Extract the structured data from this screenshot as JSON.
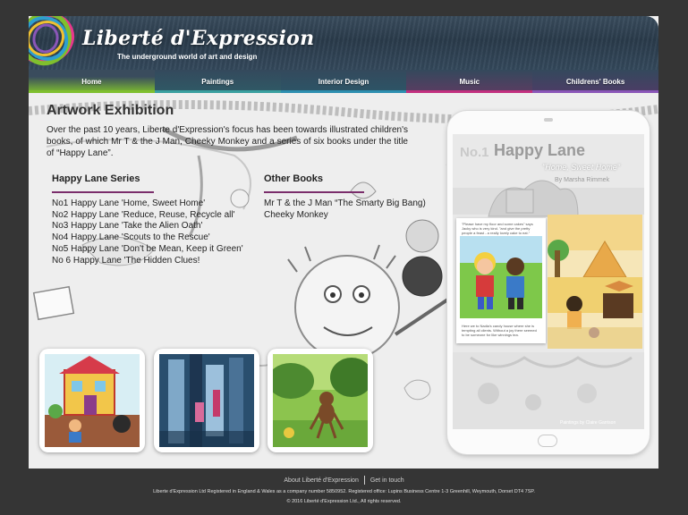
{
  "site": {
    "title": "Liberté d'Expression",
    "tagline": "The underground world of art and design"
  },
  "nav": {
    "items": [
      {
        "label": "Home",
        "color": "#7fbf2e"
      },
      {
        "label": "Paintings",
        "color": "#3aa0a0"
      },
      {
        "label": "Interior Design",
        "color": "#2d8fb0"
      },
      {
        "label": "Music",
        "color": "#c2307f"
      },
      {
        "label": "Childrens' Books",
        "color": "#8a56b8"
      }
    ],
    "active": "Home"
  },
  "main": {
    "title": "Artwork Exhibition",
    "intro": "Over the past 10 years, Liberte d'Expression's focus has been towards illustrated children's books, of which Mr T & the J Man, Cheeky Monkey and a series of six books under the title of “Happy Lane”.",
    "happy_lane": {
      "heading": "Happy Lane Series",
      "items": [
        "No1 Happy Lane 'Home, Sweet Home'",
        "No2 Happy Lane 'Reduce, Reuse, Recycle all'",
        "No3 Happy Lane 'Take the Alien Oath'",
        "No4 Happy Lane 'Scouts to the Rescue'",
        "No5 Happy Lane 'Don't be Mean, Keep it Green'",
        "No 6 Happy Lane 'The Hidden Clues!"
      ]
    },
    "other_books": {
      "heading": "Other Books",
      "items": [
        "Mr T & the J Man “The Smarty Big Bang)",
        "Cheeky Monkey"
      ]
    },
    "accent_color": "#7a2d6b"
  },
  "tablet": {
    "book_number": "No.1",
    "book_title": "Happy Lane",
    "book_subtitle": "\"Home, Sweet Home\"",
    "author": "By Marsha Rimmek",
    "page_text_top": "\"Please have my floor and some cakes\" says Jacky who is very kind. \"and give the pretty people a feast - a really lovely cake to eat.\"",
    "page_text_bottom": "Here we to Nadia's candy house where she is tempting all clients. Without a joy there seemed to be someone for like winnings tea.",
    "credit": "Paintings by Claire Garrison"
  },
  "footer": {
    "links": [
      "About Liberté d'Expression",
      "Get in touch"
    ],
    "registration": "Liberte d'Expression Ltd Registered in England & Wales as a company number 5850952. Registered office: Lupins Business Centre 1-3 Greenhill, Weymouth, Dorset DT4 7SP.",
    "copyright": "© 2016 Liberté d'Expression Ltd., All rights reserved."
  }
}
